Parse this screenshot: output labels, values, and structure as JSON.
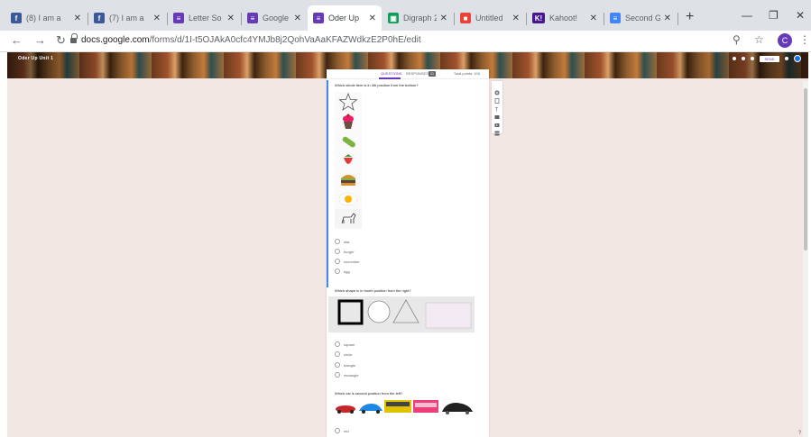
{
  "browser": {
    "tabs": [
      {
        "title": "(8) I am a",
        "fav_color": "#3b5998",
        "fav_glyph": "f"
      },
      {
        "title": "(7) I am a",
        "fav_color": "#3b5998",
        "fav_glyph": "f"
      },
      {
        "title": "Letter So",
        "fav_color": "#673ab7",
        "fav_glyph": "≡"
      },
      {
        "title": "Google F",
        "fav_color": "#673ab7",
        "fav_glyph": "≡"
      },
      {
        "title": "Oder Up",
        "fav_color": "#673ab7",
        "fav_glyph": "≡"
      },
      {
        "title": "Digraph 2",
        "fav_color": "#0f9d58",
        "fav_glyph": "▣"
      },
      {
        "title": "Untitled",
        "fav_color": "#ea4335",
        "fav_glyph": "■"
      },
      {
        "title": "Kahoot!",
        "fav_color": "#46178f",
        "fav_glyph": "K!"
      },
      {
        "title": "Second G",
        "fav_color": "#4285f4",
        "fav_glyph": "≡"
      }
    ],
    "url_domain": "docs.google.com",
    "url_path": "/forms/d/1I-t5OJAkA0cfc4YMJb8j2QohVaAaKFAZWdkzE2P0hE/edit",
    "avatar_letter": "C"
  },
  "form": {
    "title": "Oder Up Unit 1",
    "tabs": [
      "QUESTIONS",
      "RESPONSES"
    ],
    "responses_count": "11",
    "total_points": "Total points: 100",
    "send_label": "SEND",
    "question1": "Which whole item is in 4th position from the bottom?",
    "q1_options": [
      "star",
      "burger",
      "cucumber",
      "egg"
    ],
    "question2": "Which shape is in fourth position from the right?",
    "q2_options": [
      "square",
      "circle",
      "triangle",
      "rectangle"
    ],
    "question3": "Which car is second position from the left?",
    "q3_options": [
      "red"
    ]
  }
}
